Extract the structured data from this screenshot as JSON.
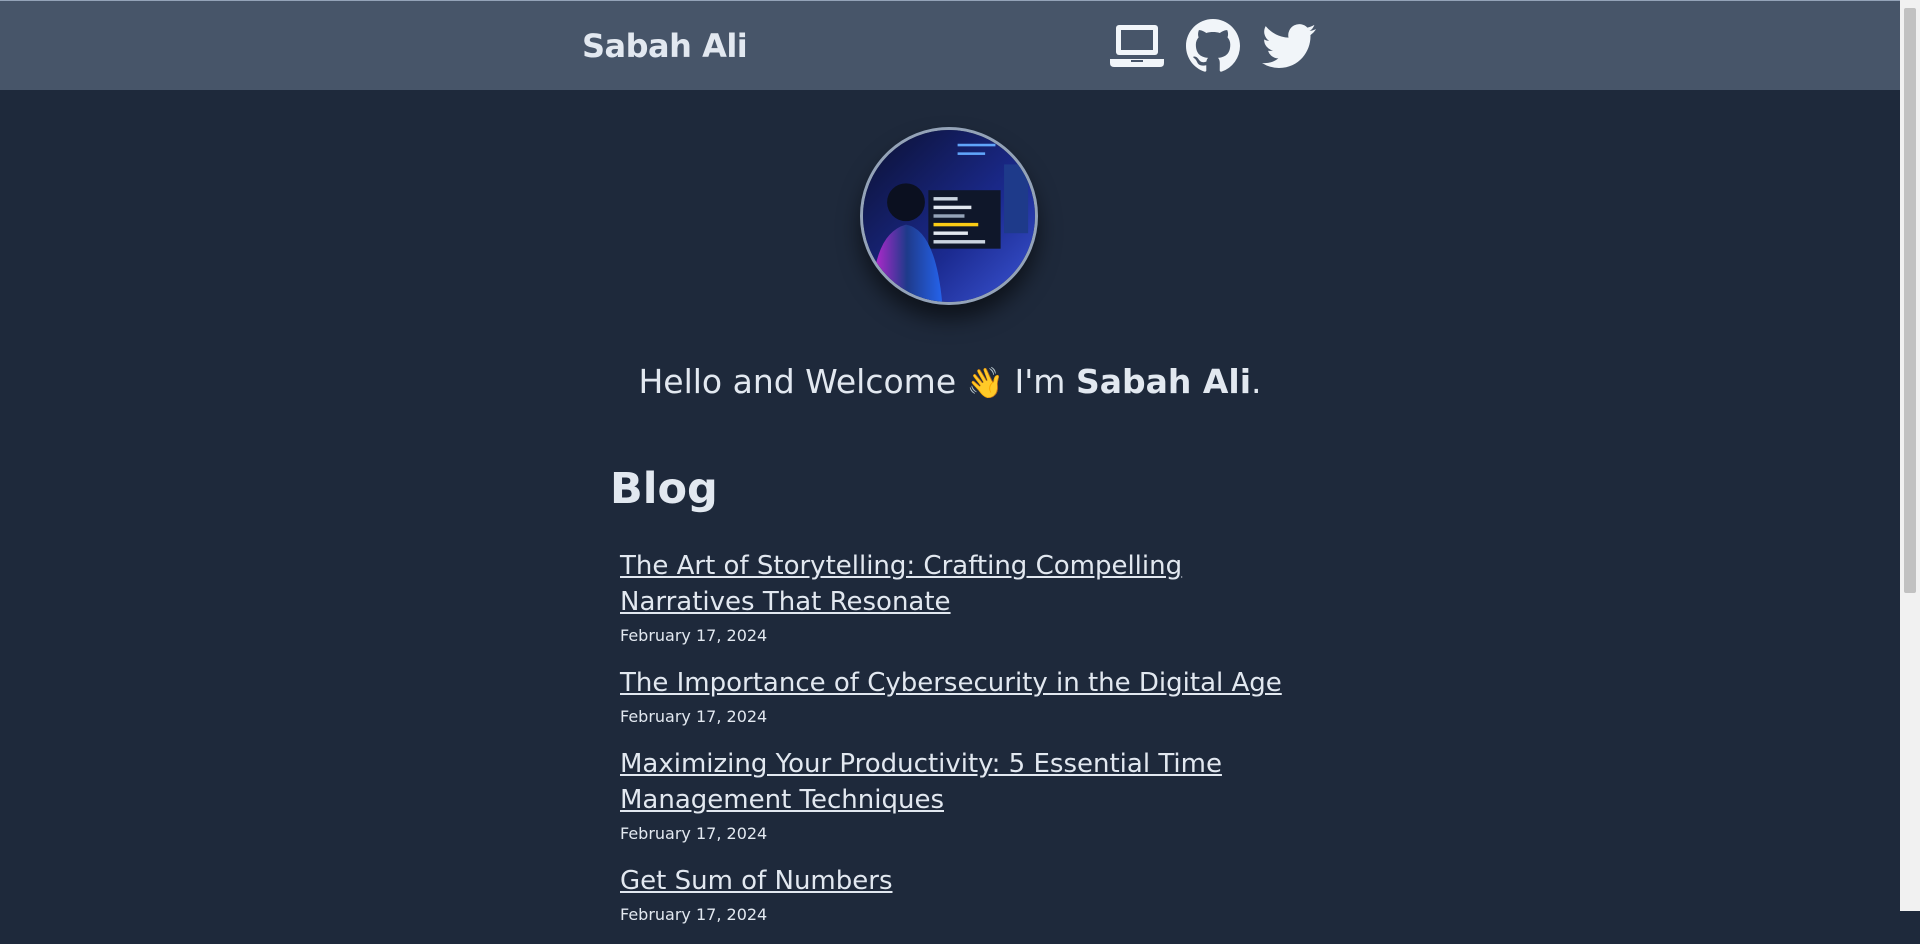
{
  "header": {
    "site_title": "Sabah Ali",
    "nav_icons": [
      "laptop-icon",
      "github-icon",
      "twitter-icon"
    ]
  },
  "profile": {
    "greeting_prefix": "Hello and Welcome",
    "wave_emoji": "👋",
    "greeting_mid": "I'm",
    "name": "Sabah Ali",
    "greeting_suffix": "."
  },
  "blog": {
    "heading": "Blog",
    "posts": [
      {
        "title": "The Art of Storytelling: Crafting Compelling Narratives That Resonate",
        "date": "February 17, 2024"
      },
      {
        "title": "The Importance of Cybersecurity in the Digital Age",
        "date": "February 17, 2024"
      },
      {
        "title": "Maximizing Your Productivity: 5 Essential Time Management Techniques",
        "date": "February 17, 2024"
      },
      {
        "title": "Get Sum of Numbers",
        "date": "February 17, 2024"
      }
    ]
  },
  "colors": {
    "page_bg": "#1e293b",
    "header_bg": "#475569",
    "text": "#e2e8f0"
  }
}
